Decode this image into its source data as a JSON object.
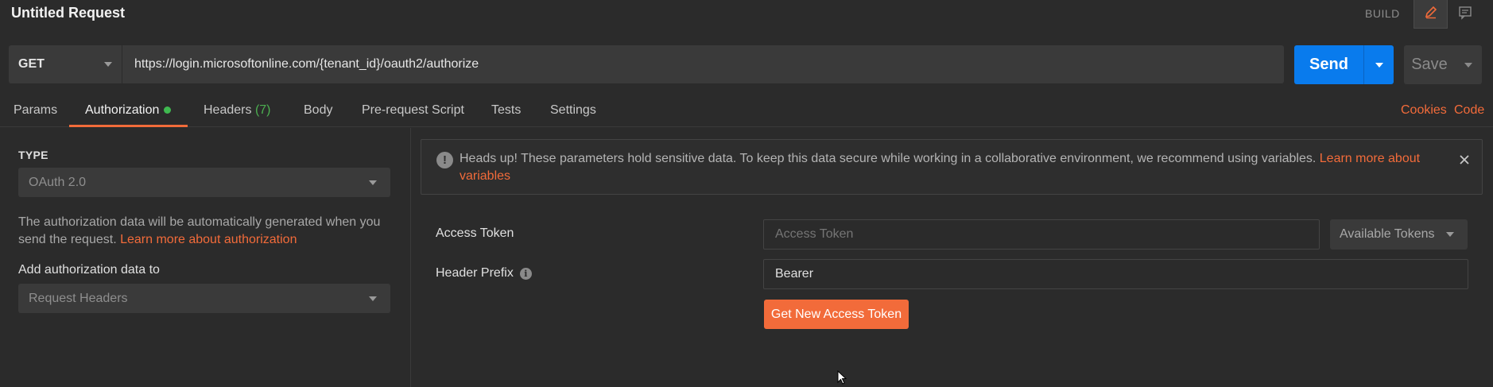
{
  "titlebar": {
    "title": "Untitled Request",
    "mode_label": "BUILD",
    "icons": [
      "pencil-icon",
      "comment-icon"
    ]
  },
  "request": {
    "method": "GET",
    "url": "https://login.microsoftonline.com/{tenant_id}/oauth2/authorize",
    "send_label": "Send",
    "save_label": "Save"
  },
  "tabs": {
    "items": [
      {
        "label": "Params"
      },
      {
        "label": "Authorization",
        "active": true
      },
      {
        "label": "Headers",
        "count": "(7)"
      },
      {
        "label": "Body"
      },
      {
        "label": "Pre-request Script"
      },
      {
        "label": "Tests"
      },
      {
        "label": "Settings"
      }
    ],
    "right_links": [
      "Cookies",
      "Code"
    ]
  },
  "auth": {
    "type_label": "TYPE",
    "type_value": "OAuth 2.0",
    "description": "The authorization data will be automatically generated when you send the request. ",
    "description_link": "Learn more about authorization",
    "add_to_label": "Add authorization data to",
    "add_to_value": "Request Headers"
  },
  "alert": {
    "text": "Heads up! These parameters hold sensitive data. To keep this data secure while working in a collaborative environment, we recommend using variables. ",
    "link": "Learn more about variables"
  },
  "form": {
    "access_token_label": "Access Token",
    "access_token_placeholder": "Access Token",
    "available_tokens_label": "Available Tokens",
    "header_prefix_label": "Header Prefix",
    "header_prefix_value": "Bearer",
    "get_token_label": "Get New Access Token"
  },
  "colors": {
    "accent": "#f26b3a",
    "send": "#097bed",
    "background": "#2b2b2b",
    "status_dot": "#3fb950"
  }
}
